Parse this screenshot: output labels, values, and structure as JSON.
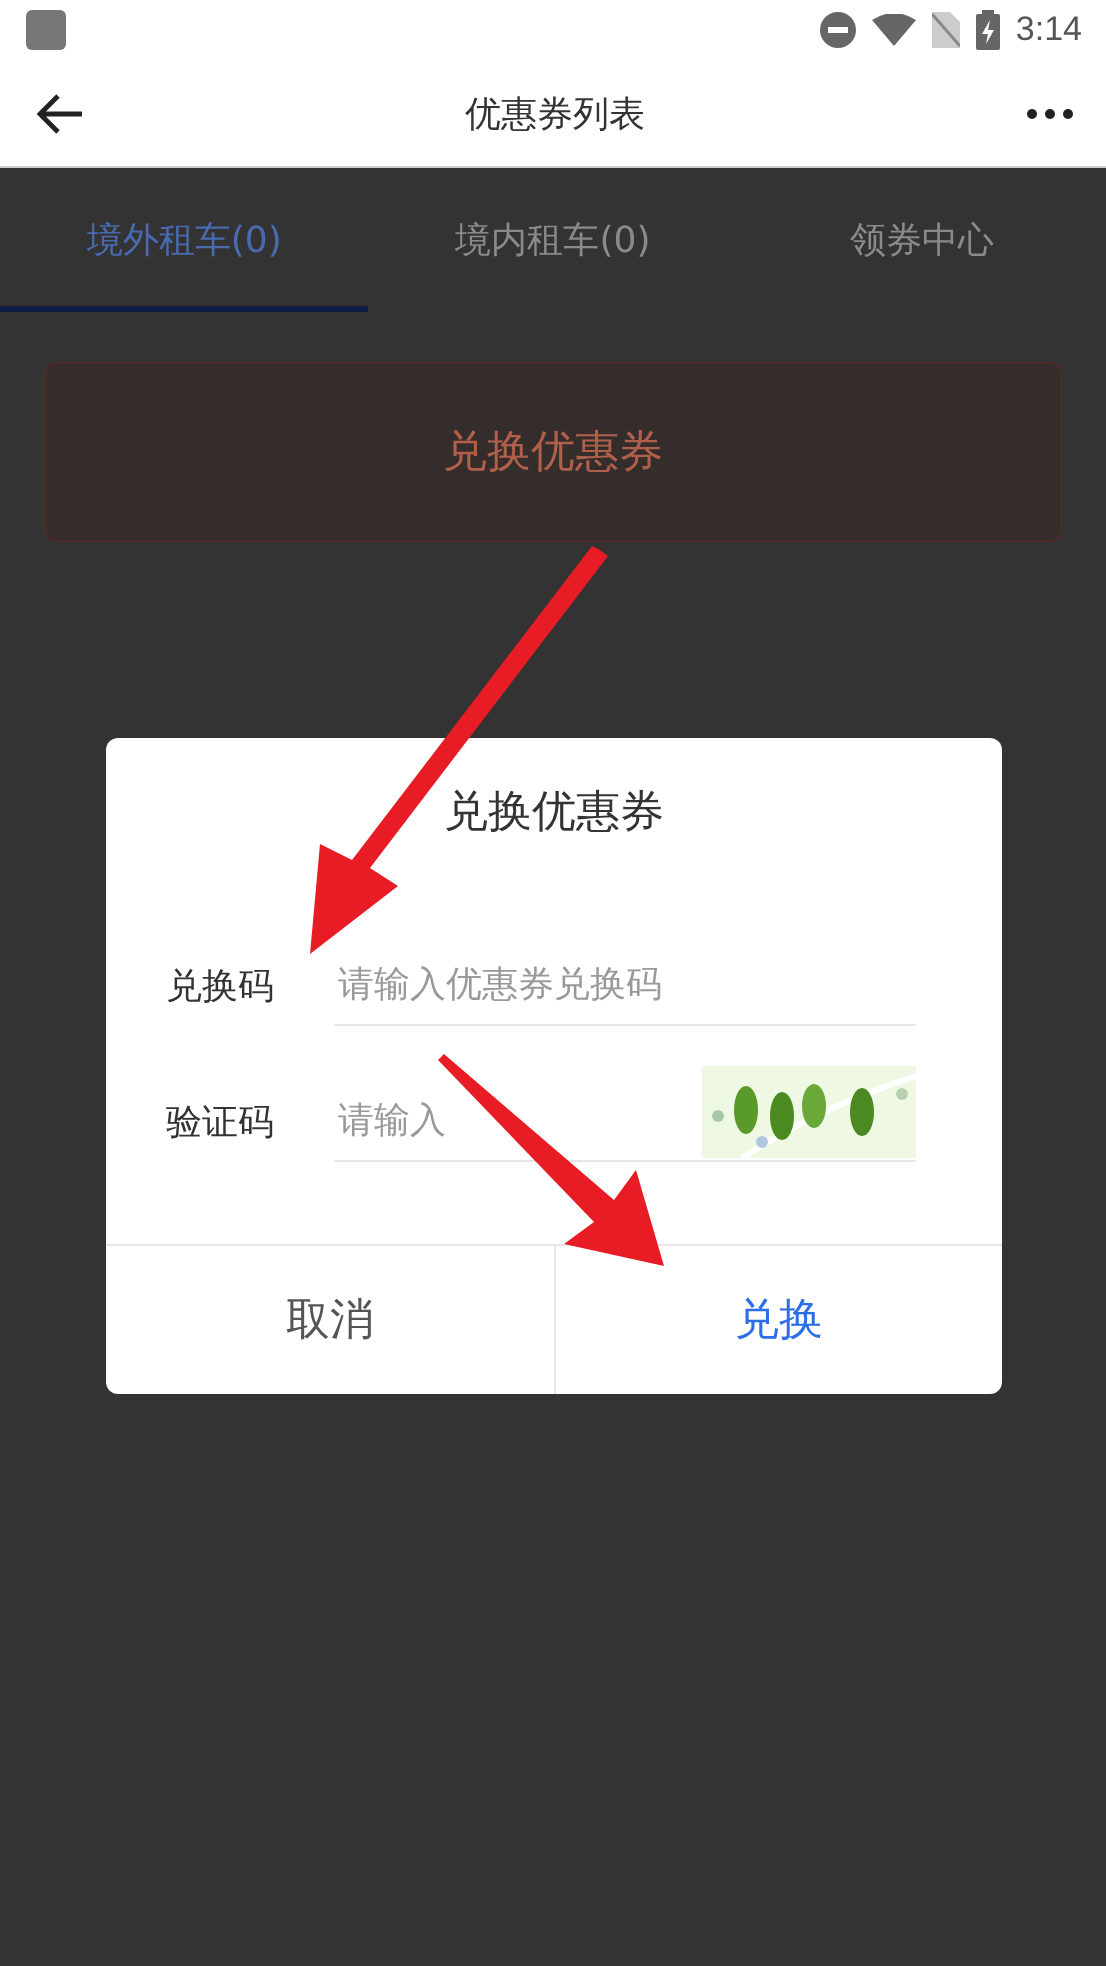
{
  "status_bar": {
    "time": "3:14"
  },
  "app_bar": {
    "title": "优惠券列表"
  },
  "tabs": [
    {
      "label": "境外租车(0)",
      "selected": true
    },
    {
      "label": "境内租车(0)",
      "selected": false
    },
    {
      "label": "领券中心",
      "selected": false
    }
  ],
  "redeem_button": {
    "label": "兑换优惠券"
  },
  "dialog": {
    "title": "兑换优惠券",
    "fields": [
      {
        "label": "兑换码",
        "placeholder": "请输入优惠券兑换码",
        "kind": "text"
      },
      {
        "label": "验证码",
        "placeholder": "请输入",
        "kind": "captcha"
      }
    ],
    "buttons": [
      {
        "label": "取消",
        "kind": "secondary"
      },
      {
        "label": "兑换",
        "kind": "primary"
      }
    ]
  }
}
